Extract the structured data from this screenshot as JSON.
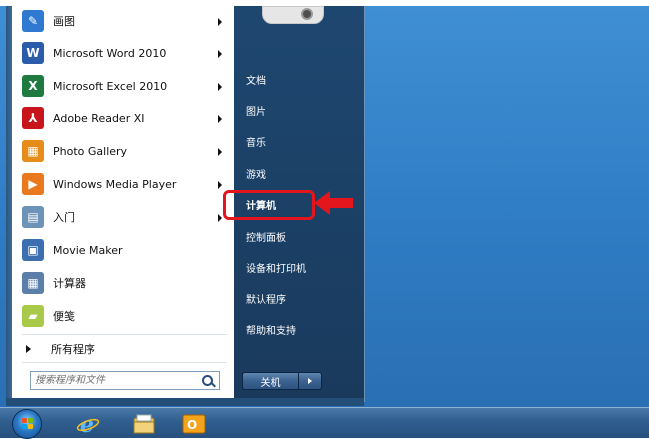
{
  "start_menu": {
    "programs": [
      {
        "label": "画图",
        "icon": "paint-icon",
        "color": "#2f7ad0",
        "glyph": "🎨",
        "has_arrow": true
      },
      {
        "label": "Microsoft Word 2010",
        "icon": "word-icon",
        "color": "#2b5caa",
        "glyph": "W",
        "has_arrow": true
      },
      {
        "label": "Microsoft Excel 2010",
        "icon": "excel-icon",
        "color": "#1f7a3f",
        "glyph": "X",
        "has_arrow": true
      },
      {
        "label": "Adobe Reader XI",
        "icon": "adobe-reader-icon",
        "color": "#c8151b",
        "glyph": "⅄",
        "has_arrow": true
      },
      {
        "label": "Photo Gallery",
        "icon": "photo-gallery-icon",
        "color": "#e58c1a",
        "glyph": "▦",
        "has_arrow": true
      },
      {
        "label": "Windows Media Player",
        "icon": "media-player-icon",
        "color": "#e9791c",
        "glyph": "▶",
        "has_arrow": true
      },
      {
        "label": "入门",
        "icon": "getting-started-icon",
        "color": "#6e93b8",
        "glyph": "▤",
        "has_arrow": true
      },
      {
        "label": "Movie Maker",
        "icon": "movie-maker-icon",
        "color": "#3b6fb0",
        "glyph": "▣",
        "has_arrow": false
      },
      {
        "label": "计算器",
        "icon": "calculator-icon",
        "color": "#5b7fa8",
        "glyph": "▦",
        "has_arrow": false
      },
      {
        "label": "便笺",
        "icon": "sticky-notes-icon",
        "color": "#a8c94a",
        "glyph": "▰",
        "has_arrow": false
      }
    ],
    "all_programs": "所有程序",
    "search_placeholder": "搜索程序和文件",
    "right_items": [
      "文档",
      "图片",
      "音乐",
      "游戏",
      "计算机",
      "控制面板",
      "设备和打印机",
      "默认程序",
      "帮助和支持"
    ],
    "selected_right_item": "计算机",
    "shutdown_label": "关机"
  },
  "taskbar": {
    "icons": [
      "internet-explorer-icon",
      "file-explorer-icon",
      "outlook-icon"
    ]
  },
  "colors": {
    "highlight": "#e2161c",
    "desktop": "#3f8fd4"
  }
}
